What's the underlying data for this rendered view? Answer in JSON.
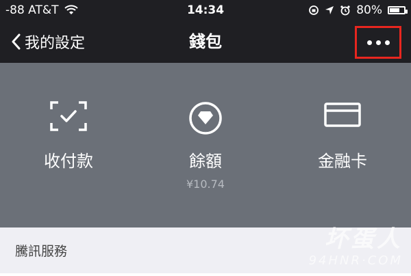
{
  "status_bar": {
    "carrier": "-88 AT&T",
    "time": "14:34",
    "battery_pct": "80%",
    "battery_level": 0.8
  },
  "nav": {
    "back_label": "我的設定",
    "title": "錢包"
  },
  "wallet": {
    "items": [
      {
        "label": "收付款",
        "icon": "scan-icon"
      },
      {
        "label": "餘額",
        "sub": "¥10.74",
        "icon": "coin-icon"
      },
      {
        "label": "金融卡",
        "icon": "card-icon"
      }
    ]
  },
  "section": {
    "title": "騰訊服務"
  },
  "watermark": {
    "line1": "坏蛋人",
    "line2": "94HNR·COM"
  },
  "colors": {
    "header_bg": "#1f1f23",
    "wallet_bg": "#6b7078",
    "highlight_box": "#e8261f",
    "page_bg": "#efeff4"
  }
}
